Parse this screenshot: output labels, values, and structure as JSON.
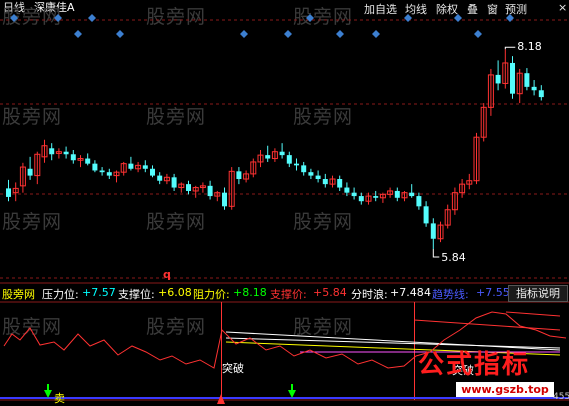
{
  "header": {
    "period": "日线",
    "stock_name": "深康佳A",
    "menu": [
      "加自选",
      "均线",
      "除权",
      "叠",
      "窗",
      "预测"
    ],
    "menu_tail": "×"
  },
  "watermark": "股旁网",
  "chart_data": {
    "type": "candlestick",
    "title": "深康佳A",
    "period": "日线",
    "ylim": [
      5.5,
      8.5
    ],
    "high_label": "8.18",
    "low_label": "5.84",
    "high_value": 8.18,
    "low_value": 5.84,
    "marker_q": "q",
    "candles": [
      [
        6.55,
        6.65,
        6.4,
        6.45
      ],
      [
        6.5,
        6.62,
        6.4,
        6.55
      ],
      [
        6.58,
        6.85,
        6.5,
        6.8
      ],
      [
        6.78,
        6.92,
        6.65,
        6.7
      ],
      [
        6.7,
        6.98,
        6.6,
        6.95
      ],
      [
        6.92,
        7.12,
        6.85,
        7.05
      ],
      [
        7.02,
        7.08,
        6.88,
        6.95
      ],
      [
        6.96,
        7.02,
        6.9,
        6.98
      ],
      [
        6.98,
        7.04,
        6.9,
        6.95
      ],
      [
        6.95,
        7.0,
        6.84,
        6.88
      ],
      [
        6.88,
        6.94,
        6.8,
        6.9
      ],
      [
        6.9,
        6.96,
        6.82,
        6.84
      ],
      [
        6.84,
        6.88,
        6.74,
        6.76
      ],
      [
        6.76,
        6.8,
        6.7,
        6.74
      ],
      [
        6.74,
        6.78,
        6.66,
        6.7
      ],
      [
        6.7,
        6.76,
        6.62,
        6.74
      ],
      [
        6.74,
        6.86,
        6.7,
        6.84
      ],
      [
        6.84,
        6.92,
        6.76,
        6.78
      ],
      [
        6.78,
        6.86,
        6.74,
        6.82
      ],
      [
        6.82,
        6.88,
        6.74,
        6.78
      ],
      [
        6.78,
        6.82,
        6.68,
        6.7
      ],
      [
        6.7,
        6.74,
        6.6,
        6.64
      ],
      [
        6.64,
        6.72,
        6.6,
        6.68
      ],
      [
        6.68,
        6.72,
        6.52,
        6.56
      ],
      [
        6.56,
        6.62,
        6.5,
        6.6
      ],
      [
        6.6,
        6.64,
        6.48,
        6.52
      ],
      [
        6.52,
        6.58,
        6.44,
        6.56
      ],
      [
        6.56,
        6.62,
        6.5,
        6.58
      ],
      [
        6.58,
        6.64,
        6.42,
        6.46
      ],
      [
        6.46,
        6.52,
        6.4,
        6.5
      ],
      [
        6.5,
        6.56,
        6.3,
        6.34
      ],
      [
        6.34,
        6.8,
        6.3,
        6.75
      ],
      [
        6.75,
        6.8,
        6.6,
        6.66
      ],
      [
        6.66,
        6.76,
        6.62,
        6.72
      ],
      [
        6.72,
        6.9,
        6.68,
        6.86
      ],
      [
        6.86,
        7.0,
        6.8,
        6.94
      ],
      [
        6.94,
        7.05,
        6.86,
        6.9
      ],
      [
        6.9,
        7.02,
        6.86,
        6.98
      ],
      [
        6.98,
        7.08,
        6.9,
        6.94
      ],
      [
        6.94,
        6.98,
        6.8,
        6.84
      ],
      [
        6.84,
        6.9,
        6.76,
        6.82
      ],
      [
        6.82,
        6.86,
        6.7,
        6.74
      ],
      [
        6.74,
        6.78,
        6.66,
        6.7
      ],
      [
        6.7,
        6.76,
        6.62,
        6.66
      ],
      [
        6.66,
        6.72,
        6.56,
        6.6
      ],
      [
        6.6,
        6.7,
        6.56,
        6.66
      ],
      [
        6.66,
        6.7,
        6.52,
        6.56
      ],
      [
        6.56,
        6.62,
        6.46,
        6.5
      ],
      [
        6.5,
        6.56,
        6.42,
        6.46
      ],
      [
        6.46,
        6.5,
        6.36,
        6.4
      ],
      [
        6.4,
        6.5,
        6.36,
        6.46
      ],
      [
        6.46,
        6.52,
        6.4,
        6.44
      ],
      [
        6.44,
        6.5,
        6.38,
        6.48
      ],
      [
        6.48,
        6.56,
        6.44,
        6.52
      ],
      [
        6.52,
        6.56,
        6.4,
        6.44
      ],
      [
        6.44,
        6.52,
        6.4,
        6.5
      ],
      [
        6.5,
        6.6,
        6.44,
        6.46
      ],
      [
        6.46,
        6.5,
        6.3,
        6.34
      ],
      [
        6.34,
        6.4,
        6.1,
        6.14
      ],
      [
        6.14,
        6.2,
        5.84,
        5.96
      ],
      [
        5.96,
        6.16,
        5.92,
        6.12
      ],
      [
        6.12,
        6.36,
        6.08,
        6.3
      ],
      [
        6.3,
        6.56,
        6.24,
        6.5
      ],
      [
        6.5,
        6.66,
        6.44,
        6.6
      ],
      [
        6.6,
        6.72,
        6.54,
        6.64
      ],
      [
        6.64,
        7.2,
        6.6,
        7.15
      ],
      [
        7.15,
        7.55,
        7.1,
        7.5
      ],
      [
        7.5,
        7.95,
        7.4,
        7.88
      ],
      [
        7.88,
        8.05,
        7.7,
        7.78
      ],
      [
        7.78,
        8.18,
        7.72,
        8.02
      ],
      [
        8.02,
        8.1,
        7.6,
        7.66
      ],
      [
        7.66,
        7.95,
        7.55,
        7.9
      ],
      [
        7.9,
        7.96,
        7.7,
        7.74
      ],
      [
        7.74,
        7.82,
        7.64,
        7.7
      ],
      [
        7.7,
        7.76,
        7.58,
        7.62
      ]
    ],
    "indicator_names": [
      "股旁网",
      "压力位:",
      "支撑位:",
      "阻力价:",
      "支撑价:",
      "分时浪:",
      "趋势线:"
    ],
    "indicator_values": [
      "+7.57",
      "+6.08",
      "+8.18",
      "+5.84",
      "+7.48",
      "+7.55"
    ],
    "legend_button": "指标说明",
    "signal_labels": [
      "突破",
      "突破"
    ],
    "sell_label": "卖",
    "axis_tail": "4",
    "lower_tick": "455"
  },
  "overlay": {
    "stamp": "公式指标",
    "site": "www.gszb.top"
  },
  "colors": {
    "up": "#ff3232",
    "down": "#54fcfc",
    "grid": "#8a1a1a",
    "diamond": "#3c7fd0",
    "yellow": "#ffff00",
    "pink": "#ff55ff",
    "green": "#00ff00",
    "cyan": "#00ffff",
    "red": "#ff3232",
    "white": "#ffffff",
    "blue": "#4a5aff"
  }
}
